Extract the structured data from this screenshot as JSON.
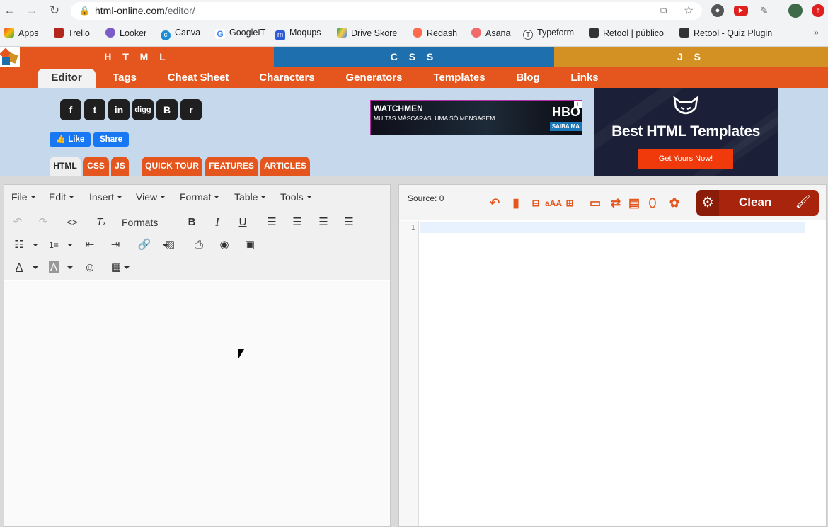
{
  "browser": {
    "url_host": "html-online.com",
    "url_path": "/editor/",
    "bookmarks": [
      "Apps",
      "Trello",
      "Looker",
      "Canva",
      "GoogleIT",
      "Moqups",
      "Drive Skore",
      "Redash",
      "Asana",
      "Typeform",
      "Retool | público",
      "Retool - Quiz Plugin"
    ],
    "more": "»"
  },
  "site": {
    "strips": [
      "H T M L",
      "C S S",
      "J S"
    ],
    "strip_colors": [
      "#e4561d",
      "#1e6fad",
      "#d39124"
    ],
    "menu": [
      "Editor",
      "Tags",
      "Cheat Sheet",
      "Characters",
      "Generators",
      "Templates",
      "Blog",
      "Links"
    ]
  },
  "social": {
    "icons": [
      "f",
      "t",
      "in",
      "digg",
      "B",
      "r"
    ],
    "like": "Like",
    "share": "Share"
  },
  "tabs": [
    "HTML",
    "CSS",
    "JS",
    "QUICK TOUR",
    "FEATURES",
    "ARTICLES"
  ],
  "ads": {
    "watchmen_title": "WATCHMEN",
    "watchmen_sub": "MUITAS MÁSCARAS, UMA SÓ MENSAGEM.",
    "watchmen_brand": "HBO",
    "watchmen_cta": "SAIBA MA",
    "templates_title": "Best HTML Templates",
    "templates_cta": "Get Yours Now!"
  },
  "wysiwyg": {
    "menu": [
      "File",
      "Edit",
      "Insert",
      "View",
      "Format",
      "Table",
      "Tools"
    ],
    "formats": "Formats"
  },
  "source": {
    "label": "Source: 0",
    "clean": "Clean",
    "line": "1"
  }
}
